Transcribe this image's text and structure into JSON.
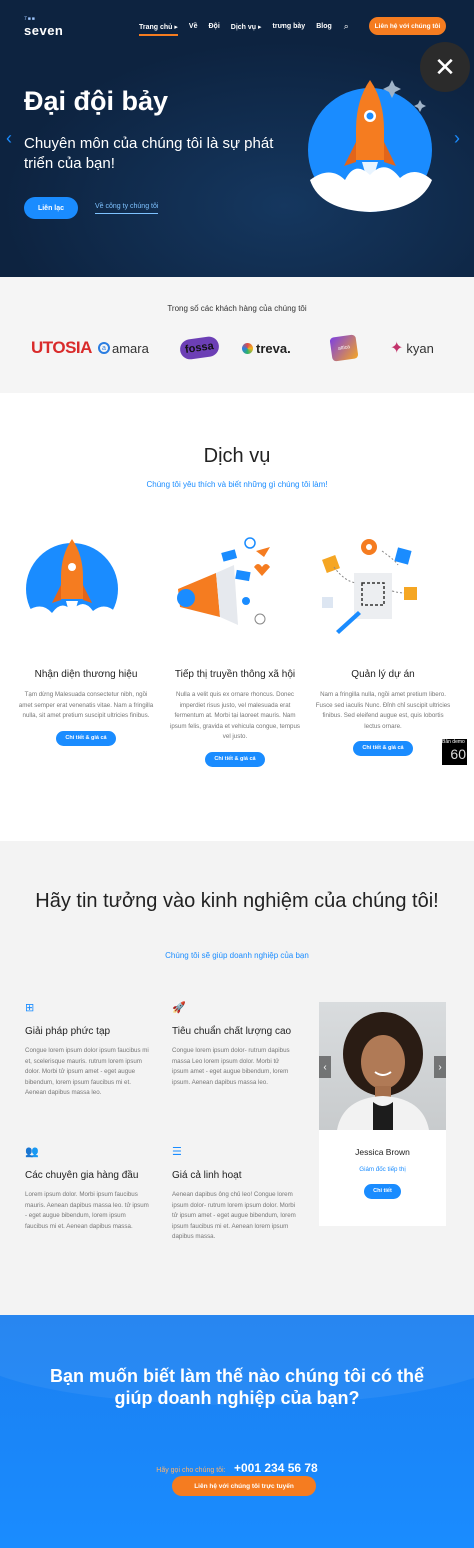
{
  "nav": {
    "logo_small": "7■■",
    "logo_main": "seven",
    "items": [
      "Trang chủ ▸",
      "Về",
      "Đội",
      "Dịch vụ ▸",
      "trưng bày",
      "Blog"
    ],
    "cta": "Liên hệ với chúng tôi"
  },
  "hero": {
    "title": "Đại đội bảy",
    "subtitle": "Chuyên môn của chúng tôi là sự phát triển của bạn!",
    "button": "Liên lạc",
    "link": "Về công ty chúng tôi"
  },
  "clients": {
    "title": "Trong số các khách hàng của chúng tôi",
    "logos": [
      "UTOSIA",
      "amara",
      "fossa",
      "treva.",
      "attica",
      "kyan"
    ]
  },
  "services": {
    "title": "Dịch vụ",
    "subtitle": "Chúng tôi yêu thích và biết những gì chúng tôi làm!",
    "items": [
      {
        "title": "Nhận diện thương hiệu",
        "text": "Tạm dừng Malesuada consectetur nibh, ngồi amet semper erat venenatis vitae. Nam a fringilla nulla, sit amet pretium suscipit ultricies finibus.",
        "button": "Chi tiết & giá cả"
      },
      {
        "title": "Tiếp thị truyền thông xã hội",
        "text": "Nulla a velit quis ex ornare rhoncus. Donec imperdiet risus justo, vel malesuada erat fermentum at. Morbi tại laoreet mauris. Nam ipsum felis, gravida et vehicula congue, tempus vel justo.",
        "button": "Chi tiết & giá cả"
      },
      {
        "title": "Quản lý dự án",
        "text": "Nam a fringilla nulla, ngồi amet pretium libero. Fusce sed iaculis Nunc. Đỉnh chỉ suscipit ultricies finibus. Sed eleifend augue est, quis lobortis lectus ornare.",
        "button": "Chi tiết & giá cả"
      }
    ],
    "badge_text": "Bản demo",
    "badge_number": "60"
  },
  "trust": {
    "title": "Hãy tin tưởng vào kinh nghiệm của chúng tôi!",
    "subtitle": "Chúng tôi sẽ giúp doanh nghiệp của bạn",
    "features": [
      {
        "icon": "sitemap-icon",
        "glyph": "⊞",
        "title": "Giải pháp phức tạp",
        "text": "Congue lorem ipsum dolor ipsum faucibus mi et, scelerisque mauris. rutrum lorem ipsum dolor. Morbi tử ipsum amet - eget augue bibendum, lorem ipsum faucibus mi et. Aenean dapibus massa leo."
      },
      {
        "icon": "rocket-icon",
        "glyph": "🚀",
        "title": "Tiêu chuẩn chất lượng cao",
        "text": "Congue lorem ipsum dolor- rutrum dapibus massa Leo lorem ipsum dolor. Morbi tử ipsum amet - eget augue bibendum, lorem ipsum. Aenean dapibus massa leo."
      },
      {
        "icon": "users-icon",
        "glyph": "👥",
        "title": "Các chuyên gia hàng đầu",
        "text": "Lorem ipsum dolor. Morbi ipsum faucibus mauris. Aenean dapibus massa leo. tử ipsum - eget augue bibendum, lorem ipsum faucibus mi et. Aenean dapibus massa."
      },
      {
        "icon": "sliders-icon",
        "glyph": "☰",
        "title": "Giá cả linh hoạt",
        "text": "Aenean dapibus ông chủ leo! Congue lorem ipsum dolor- rutrum lorem ipsum dolor. Morbi tử ipsum amet - eget augue bibendum, lorem ipsum faucibus mi et. Aenean lorem ipsum dapibus massa."
      }
    ],
    "team": {
      "name": "Jessica Brown",
      "role": "Giám đốc tiếp thị",
      "button": "Chi tiết"
    }
  },
  "cta": {
    "title": "Bạn muốn biết làm thế nào chúng tôi có thể giúp doanh nghiệp của bạn?",
    "call_label": "Hãy gọi cho chúng tôi:",
    "phone": "+001 234 56 78",
    "button": "Liên hệ với chúng tôi trực tuyến"
  },
  "colors": {
    "accent": "#1a8cff",
    "orange": "#f57c20",
    "navy": "#0d2340"
  }
}
